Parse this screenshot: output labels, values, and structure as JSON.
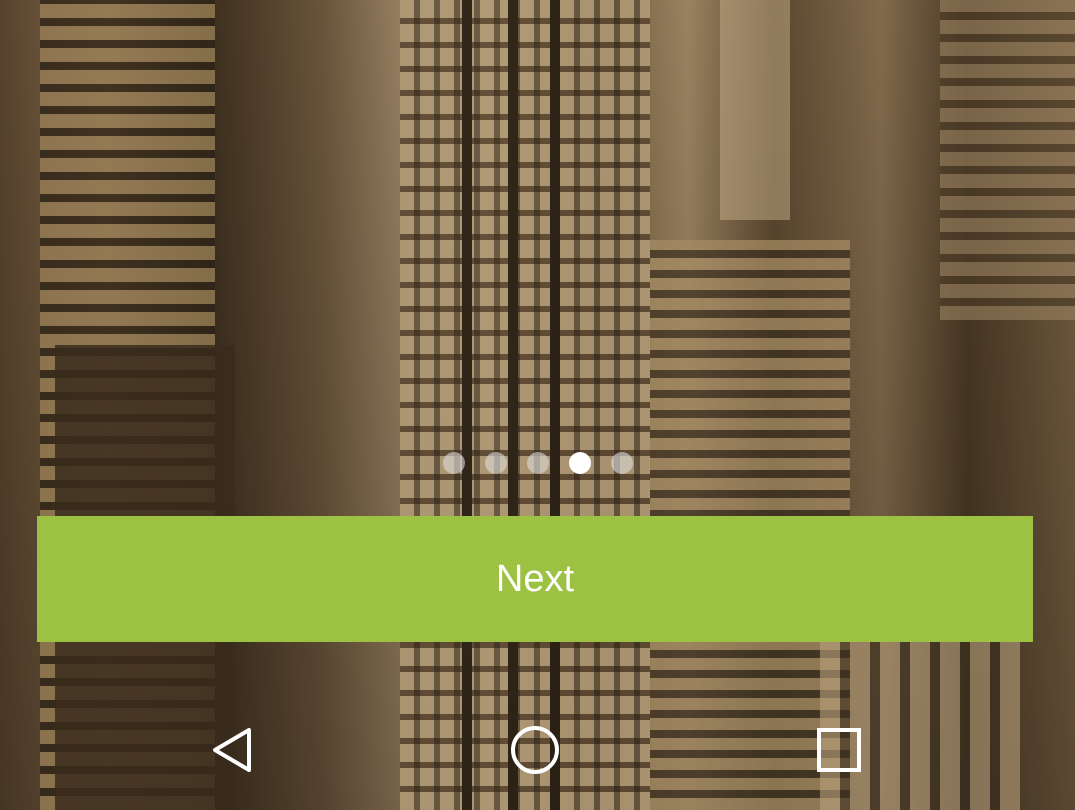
{
  "background": {
    "description_icon": "city-skyline-photo"
  },
  "pager": {
    "count": 5,
    "active_index": 3
  },
  "next_button": {
    "label": "Next",
    "color": "#9dc142"
  },
  "nav_bar": {
    "back_icon": "back-triangle-icon",
    "home_icon": "home-circle-icon",
    "recent_icon": "recent-apps-square-icon"
  }
}
